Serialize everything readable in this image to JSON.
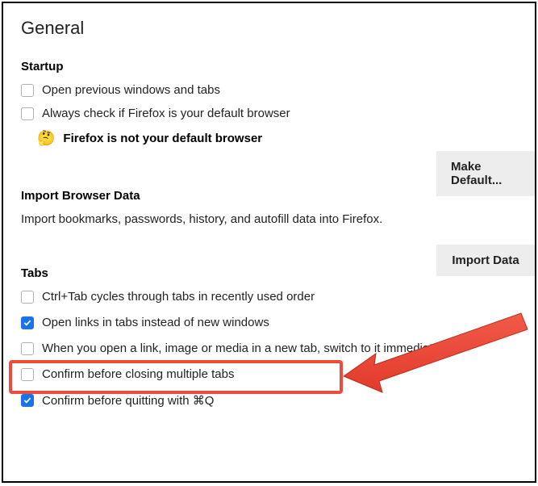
{
  "pageTitle": "General",
  "sections": {
    "startup": {
      "header": "Startup",
      "opt1": "Open previous windows and tabs",
      "opt2": "Always check if Firefox is your default browser",
      "notDefault": "Firefox is not your default browser",
      "makeDefaultBtn": "Make Default..."
    },
    "import": {
      "header": "Import Browser Data",
      "desc": "Import bookmarks, passwords, history, and autofill data into Firefox.",
      "importBtn": "Import Data"
    },
    "tabs": {
      "header": "Tabs",
      "opt1": "Ctrl+Tab cycles through tabs in recently used order",
      "opt2": "Open links in tabs instead of new windows",
      "opt3": "When you open a link, image or media in a new tab, switch to it immediately",
      "opt4": "Confirm before closing multiple tabs",
      "opt5": "Confirm before quitting with ⌘Q"
    }
  }
}
